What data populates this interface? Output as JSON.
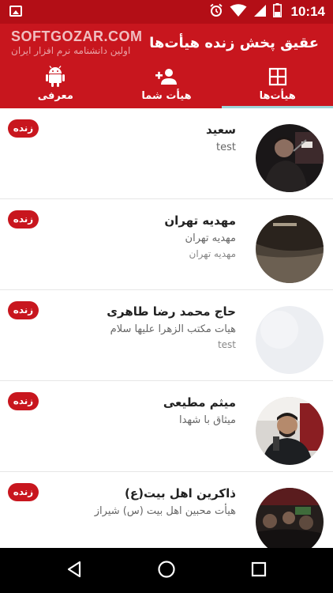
{
  "status_bar": {
    "time": "10:14",
    "icons": [
      "image-notification-icon",
      "alarm-icon",
      "wifi-icon",
      "signal-icon",
      "battery-icon"
    ]
  },
  "app_bar": {
    "title": "عقیق پخش زنده هیأت‌ها",
    "watermark": "SOFTGOZAR.COM",
    "watermark_sub": "اولین دانشنامه نرم افزار ایران",
    "colors": {
      "primary": "#c8161e",
      "status": "#b30e16",
      "indicator": "#9fd4d8"
    }
  },
  "tabs": [
    {
      "label": "معرفی",
      "icon": "android-icon",
      "active": false
    },
    {
      "label": "هیأت شما",
      "icon": "add-person-icon",
      "active": false
    },
    {
      "label": "هیأت‌ها",
      "icon": "grid-icon",
      "active": true
    }
  ],
  "live_badge_label": "زنده",
  "items": [
    {
      "name": "سعید",
      "sub1": "test",
      "sub2": "",
      "live": true
    },
    {
      "name": "مهدیه تهران",
      "sub1": "مهدیه تهران",
      "sub2": "مهدیه تهران",
      "live": true
    },
    {
      "name": "حاج محمد رضا طاهری",
      "sub1": "هیات مکتب الزهرا علیها سلام",
      "sub2": "test",
      "live": true
    },
    {
      "name": "میثم مطیعی",
      "sub1": "میثاق با شهدا",
      "sub2": "",
      "live": true
    },
    {
      "name": "ذاکرین اهل بیت(ع)",
      "sub1": "هیأت محبین اهل بیت (س) شیراز",
      "sub2": "",
      "live": true
    }
  ],
  "nav_bar": {
    "icons": [
      "back-icon",
      "home-icon",
      "recents-icon"
    ]
  }
}
